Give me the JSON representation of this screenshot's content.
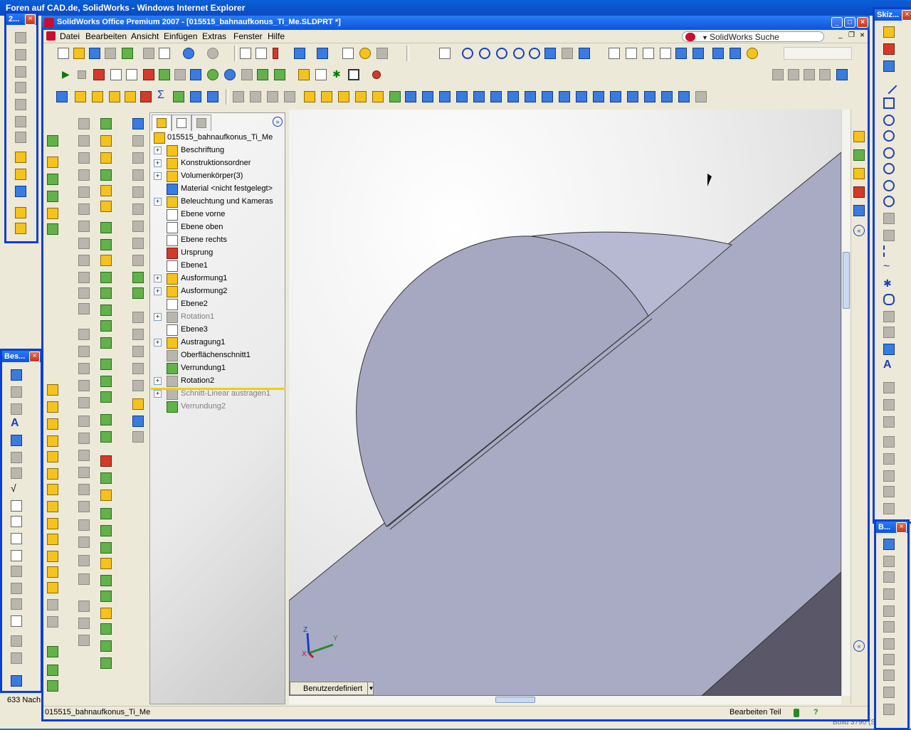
{
  "browser": {
    "title": "Foren auf CAD.de, SolidWorks - Windows Internet Explorer",
    "status_snippet": "633 Nach",
    "build_text": "Build 3790 (Servic"
  },
  "window": {
    "title": "SolidWorks Office Premium 2007 - [015515_bahnaufkonus_Ti_Me.SLDPRT *]"
  },
  "menu": [
    "Datei",
    "Bearbeiten",
    "Ansicht",
    "Einfügen",
    "Extras",
    "Fenster",
    "Hilfe"
  ],
  "search": {
    "placeholder": "SolidWorks Suche"
  },
  "palettes": {
    "left_top": "2...",
    "left_bottom": "Bes...",
    "right_top": "Skiz...",
    "right_bottom": "B..."
  },
  "tree": {
    "root": "015515_bahnaufkonus_Ti_Me",
    "items": [
      {
        "label": "Beschriftung",
        "expand": true,
        "icon": "annotation-icon",
        "gray": false
      },
      {
        "label": "Konstruktionsordner",
        "expand": true,
        "icon": "folder-icon",
        "gray": false
      },
      {
        "label": "Volumenkörper(3)",
        "expand": true,
        "icon": "solid-bodies-icon",
        "gray": false
      },
      {
        "label": "Material <nicht festgelegt>",
        "expand": false,
        "icon": "material-icon",
        "gray": false
      },
      {
        "label": "Beleuchtung und Kameras",
        "expand": true,
        "icon": "lights-icon",
        "gray": false
      },
      {
        "label": "Ebene vorne",
        "expand": false,
        "icon": "plane-icon",
        "gray": false
      },
      {
        "label": "Ebene oben",
        "expand": false,
        "icon": "plane-icon",
        "gray": false
      },
      {
        "label": "Ebene rechts",
        "expand": false,
        "icon": "plane-icon",
        "gray": false
      },
      {
        "label": "Ursprung",
        "expand": false,
        "icon": "origin-icon",
        "gray": false
      },
      {
        "label": "Ebene1",
        "expand": false,
        "icon": "plane-icon",
        "gray": false
      },
      {
        "label": "Ausformung1",
        "expand": true,
        "icon": "loft-icon",
        "gray": false
      },
      {
        "label": "Ausformung2",
        "expand": true,
        "icon": "loft-icon",
        "gray": false
      },
      {
        "label": "Ebene2",
        "expand": false,
        "icon": "plane-icon",
        "gray": false
      },
      {
        "label": "Rotation1",
        "expand": true,
        "icon": "revolve-icon",
        "gray": true
      },
      {
        "label": "Ebene3",
        "expand": false,
        "icon": "plane-icon",
        "gray": false
      },
      {
        "label": "Austragung1",
        "expand": true,
        "icon": "sweep-icon",
        "gray": false
      },
      {
        "label": "Oberflächenschnitt1",
        "expand": false,
        "icon": "surface-cut-icon",
        "gray": false
      },
      {
        "label": "Verrundung1",
        "expand": false,
        "icon": "fillet-icon",
        "gray": false
      },
      {
        "label": "Rotation2",
        "expand": true,
        "icon": "revolve-icon",
        "gray": false
      },
      {
        "label": "Schnitt-Linear austragen1",
        "expand": true,
        "icon": "cut-extrude-icon",
        "gray": true
      },
      {
        "label": "Verrundung2",
        "expand": false,
        "icon": "fillet-icon",
        "gray": true
      }
    ]
  },
  "viewport": {
    "view_tab": "Benutzerdefiniert",
    "triad": {
      "x": "X",
      "y": "Y",
      "z": "Z"
    }
  },
  "status": {
    "filename": "015515_bahnaufkonus_Ti_Me",
    "mode": "Bearbeiten Teil",
    "help": "?"
  },
  "colors": {
    "accent": "#0a3fd0",
    "part_face": "#a9abc4",
    "part_dark": "#5a5868"
  }
}
